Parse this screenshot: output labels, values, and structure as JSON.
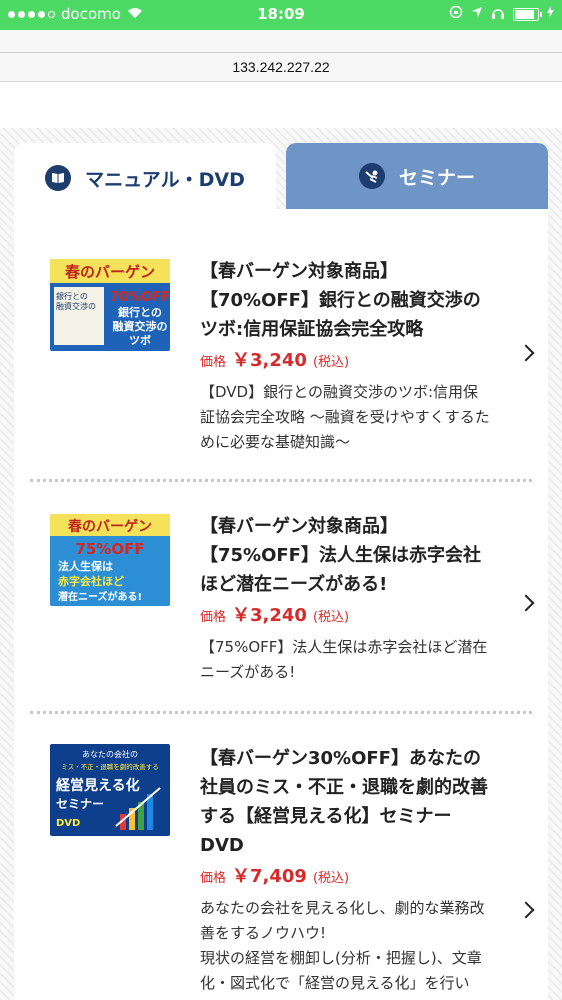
{
  "status_bar": {
    "carrier": "docomo",
    "time": "18:09",
    "signal_bars": 4,
    "signal_total": 5,
    "battery_level": 0.95
  },
  "url_bar": {
    "address": "133.242.227.22"
  },
  "tabs": [
    {
      "label": "マニュアル・DVD",
      "icon": "book-icon",
      "active": true
    },
    {
      "label": "セミナー",
      "icon": "seminar-icon",
      "active": false
    }
  ],
  "products": [
    {
      "thumb_lines": [
        "春のバーゲン",
        "銀行との",
        "融資交渉の",
        "70%OFF",
        "銀行との",
        "融資交渉の",
        "ツボ"
      ],
      "title": "【春バーゲン対象商品】【70%OFF】銀行との融資交渉のツボ:信用保証協会完全攻略",
      "price_label": "価格",
      "price": "￥3,240",
      "tax": "(税込)",
      "description": "【DVD】銀行との融資交渉のツボ:信用保証協会完全攻略 〜融資を受けやすくするために必要な基礎知識〜"
    },
    {
      "thumb_lines": [
        "春のバーゲン",
        "75%OFF",
        "法人生保は",
        "赤字会社ほど",
        "潜在ニーズがある!"
      ],
      "title": "【春バーゲン対象商品】【75%OFF】法人生保は赤字会社ほど潜在ニーズがある!",
      "price_label": "価格",
      "price": "￥3,240",
      "tax": "(税込)",
      "description": "【75%OFF】法人生保は赤字会社ほど潜在ニーズがある!"
    },
    {
      "thumb_lines": [
        "あなたの会社の",
        "ミス・不正・退職を劇的改善する",
        "経営見える化",
        "セミナー",
        "DVD"
      ],
      "title": "【春バーゲン30%OFF】あなたの社員のミス・不正・退職を劇的改善する【経営見える化】セミナーDVD",
      "price_label": "価格",
      "price": "￥7,409",
      "tax": "(税込)",
      "description": "あなたの会社を見える化し、劇的な業務改善をするノウハウ!\n現状の経営を棚卸し(分析・把握し)、文章化・図式化で「経営の見える化」を行い"
    }
  ],
  "colors": {
    "status_green": "#4cd964",
    "tab_active_text": "#1c3d6e",
    "tab_inactive_bg": "#6f95c6",
    "price_red": "#d62b2b"
  }
}
